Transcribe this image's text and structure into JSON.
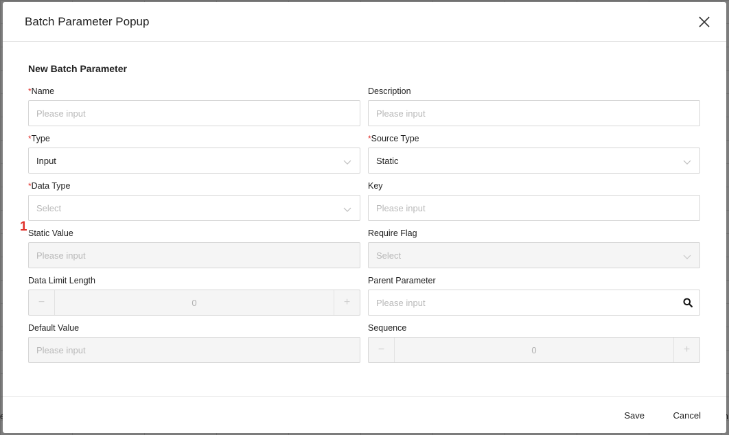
{
  "dialog": {
    "title": "Batch Parameter Popup"
  },
  "section": {
    "title": "New Batch Parameter"
  },
  "fields": {
    "name": {
      "label": "Name",
      "required": "*",
      "placeholder": "Please input"
    },
    "description": {
      "label": "Description",
      "placeholder": "Please input"
    },
    "type": {
      "label": "Type",
      "required": "*",
      "value": "Input"
    },
    "source_type": {
      "label": "Source Type",
      "required": "*",
      "value": "Static"
    },
    "data_type": {
      "label": "Data Type",
      "required": "*",
      "placeholder": "Select"
    },
    "key": {
      "label": "Key",
      "placeholder": "Please input"
    },
    "static_value": {
      "label": "Static Value",
      "placeholder": "Please input"
    },
    "require_flag": {
      "label": "Require Flag",
      "placeholder": "Select"
    },
    "data_limit_length": {
      "label": "Data Limit Length",
      "value": "0",
      "minus": "−",
      "plus": "+"
    },
    "parent_parameter": {
      "label": "Parent Parameter",
      "placeholder": "Please input"
    },
    "default_value": {
      "label": "Default Value",
      "placeholder": "Please input"
    },
    "sequence": {
      "label": "Sequence",
      "value": "0",
      "minus": "−",
      "plus": "+"
    }
  },
  "marker": {
    "text": "1"
  },
  "footer": {
    "save_label": "Save",
    "cancel_label": "Cancel"
  },
  "background": {
    "left_char": "e",
    "right_char": "n"
  },
  "colors": {
    "required_marker": "#e0312b",
    "border": "#d6d6d6",
    "disabled_bg": "#f5f5f5",
    "placeholder": "#b8b8b8"
  },
  "icons": {
    "close": "close-icon",
    "chevron": "chevron-down-icon",
    "search": "search-icon"
  }
}
